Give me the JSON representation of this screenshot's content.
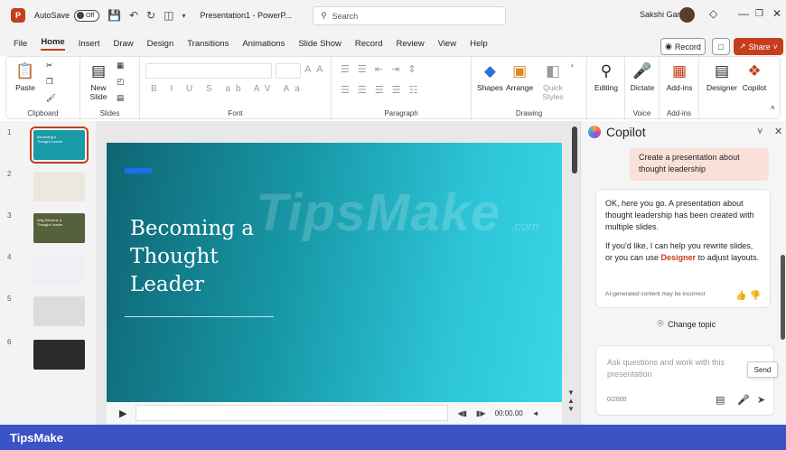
{
  "titlebar": {
    "autosave_label": "AutoSave",
    "autosave_state": "Off",
    "doc_title": "Presentation1 - PowerP...",
    "search_placeholder": "Search",
    "user_name": "Sakshi Garg"
  },
  "menu": {
    "tabs": [
      "File",
      "Home",
      "Insert",
      "Draw",
      "Design",
      "Transitions",
      "Animations",
      "Slide Show",
      "Record",
      "Review",
      "View",
      "Help"
    ],
    "active_tab": "Home",
    "record_label": "Record",
    "share_label": "Share"
  },
  "ribbon": {
    "clipboard": {
      "paste": "Paste",
      "label": "Clipboard"
    },
    "slides": {
      "new_slide": "New Slide",
      "label": "Slides"
    },
    "font": {
      "label": "Font",
      "controls": "B I U S ab AV Aa"
    },
    "paragraph": {
      "label": "Paragraph"
    },
    "drawing": {
      "shapes": "Shapes",
      "arrange": "Arrange",
      "quick_styles": "Quick Styles",
      "label": "Drawing"
    },
    "editing": {
      "label": "Editing"
    },
    "voice": {
      "dictate": "Dictate",
      "label": "Voice"
    },
    "addins": {
      "addins": "Add-ins",
      "label": "Add-ins"
    },
    "designer": "Designer",
    "copilot": "Copilot"
  },
  "thumbnails": [
    {
      "num": "1",
      "title": "Becoming a Thought Leader",
      "bg": "#1b9aa8",
      "selected": true
    },
    {
      "num": "2",
      "title": "",
      "bg": "#ece8e0"
    },
    {
      "num": "3",
      "title": "Why Become a Thought Leader",
      "bg": "#56603a"
    },
    {
      "num": "4",
      "title": "",
      "bg": "#eef0f6"
    },
    {
      "num": "5",
      "title": "",
      "bg": "#dcdcdc"
    },
    {
      "num": "6",
      "title": "",
      "bg": "#2b2b2b"
    }
  ],
  "slide": {
    "title": "Becoming a Thought Leader",
    "watermark": "TipsMake",
    "watermark_suffix": ".com",
    "time": "00:00.00"
  },
  "copilot": {
    "title": "Copilot",
    "user_message": "Create a presentation about thought leadership",
    "response_p1": "OK, here you go. A presentation about thought leadership has been created with multiple slides.",
    "response_p2_a": "If you'd like, I can help you rewrite slides, or you can use ",
    "response_link": "Designer",
    "response_p2_b": " to adjust layouts.",
    "disclaimer": "AI-generated content may be incorrect",
    "change_topic": "Change topic",
    "input_placeholder": "Ask questions and work with this presentation",
    "counter": "0/2000",
    "send_tooltip": "Send"
  },
  "footer": {
    "brand": "TipsMake"
  },
  "colors": {
    "accent": "#c43e1c",
    "footer": "#3a53c5",
    "slide_teal": "#1797a6"
  }
}
